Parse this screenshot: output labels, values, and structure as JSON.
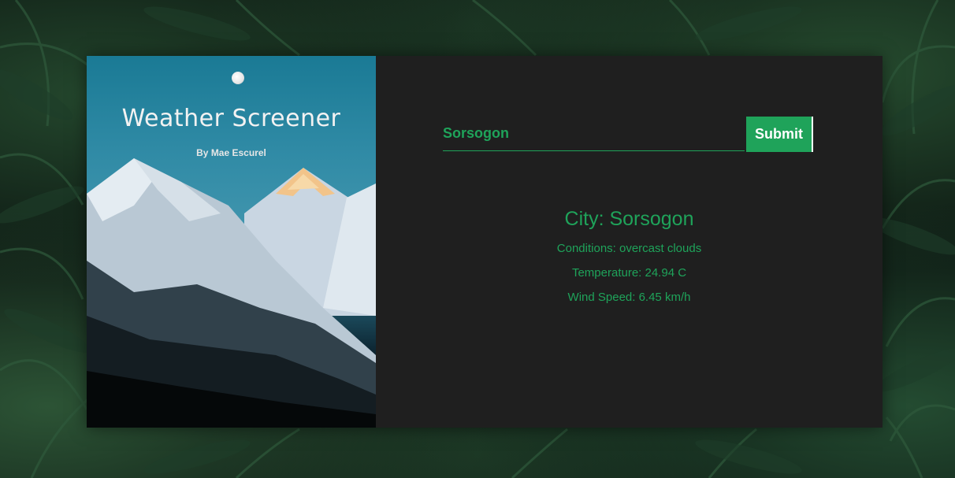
{
  "hero": {
    "title": "Weather Screener",
    "subtitle": "By Mae Escurel"
  },
  "search": {
    "value": "Sorsogon",
    "placeholder": "",
    "submit_label": "Submit"
  },
  "result": {
    "city": "City: Sorsogon",
    "conditions": "Conditions: overcast clouds",
    "temperature": "Temperature: 24.94 C",
    "wind": "Wind Speed: 6.45 km/h"
  },
  "colors": {
    "accent": "#1fa35a",
    "panel": "#1f1f1f"
  }
}
